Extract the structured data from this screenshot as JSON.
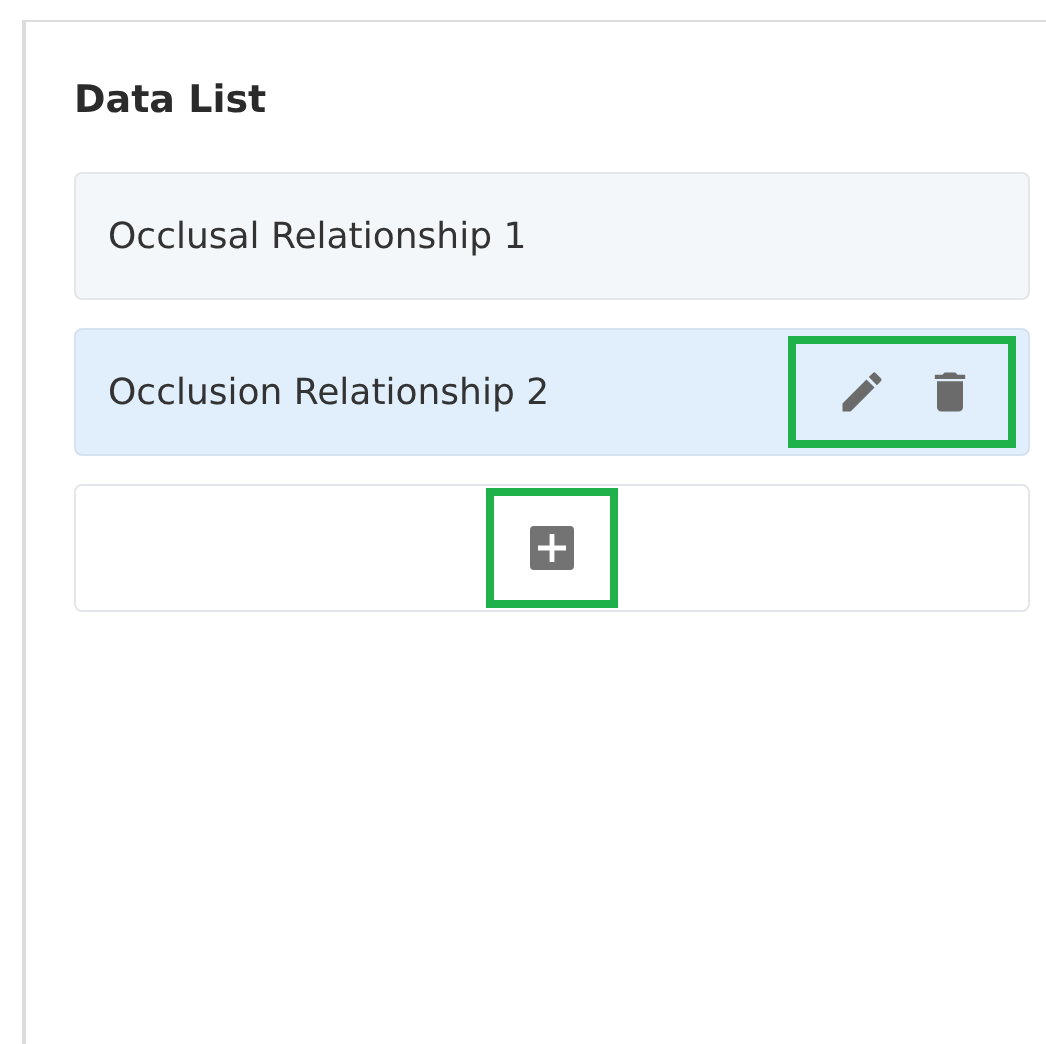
{
  "panel": {
    "title": "Data List"
  },
  "items": [
    {
      "label": "Occlusal Relationship 1",
      "selected": false
    },
    {
      "label": "Occlusion Relationship 2",
      "selected": true
    }
  ],
  "item_actions": {
    "highlighted": true
  },
  "add_button": {
    "highlighted": true
  }
}
